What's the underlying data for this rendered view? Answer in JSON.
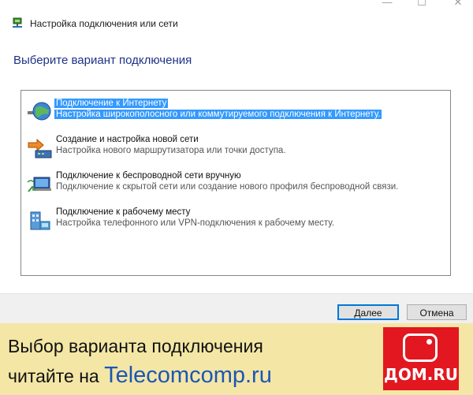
{
  "window": {
    "title": "Настройка подключения или сети",
    "minimize_glyph": "—",
    "maximize_glyph": "☐",
    "close_glyph": "✕"
  },
  "heading": "Выберите вариант подключения",
  "options": [
    {
      "title": "Подключение к Интернету",
      "description": "Настройка широкополосного или коммутируемого подключения к Интернету.",
      "icon": "globe-network-icon",
      "selected": true
    },
    {
      "title": "Создание и настройка новой сети",
      "description": "Настройка нового маршрутизатора или точки доступа.",
      "icon": "router-setup-icon",
      "selected": false
    },
    {
      "title": "Подключение к беспроводной сети вручную",
      "description": "Подключение к скрытой сети или создание нового профиля беспроводной связи.",
      "icon": "wireless-network-icon",
      "selected": false
    },
    {
      "title": "Подключение к рабочему месту",
      "description": "Настройка телефонного или VPN-подключения к рабочему месту.",
      "icon": "workplace-connection-icon",
      "selected": false
    }
  ],
  "buttons": {
    "next": "Далее",
    "cancel": "Отмена"
  },
  "banner": {
    "line1": "Выбор варианта подключения",
    "line2_prefix": "читайте на ",
    "site": "Telecomcomp.ru",
    "logo_text": "ДОМ.RU"
  },
  "colors": {
    "selection": "#3399ff",
    "heading": "#1e3287",
    "banner_bg": "#f4e6a5",
    "logo_bg": "#e2171f",
    "site_link": "#1a56b8"
  }
}
